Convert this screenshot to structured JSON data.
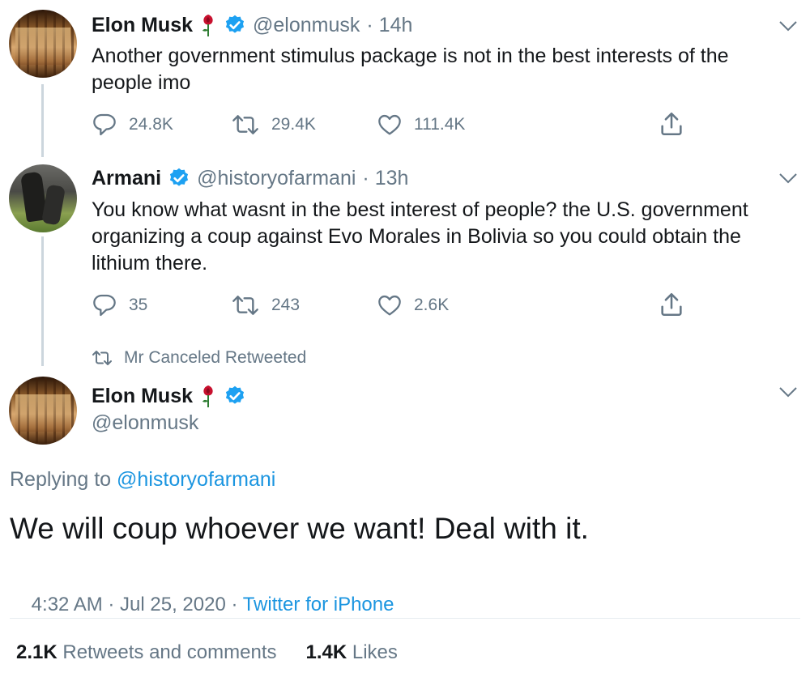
{
  "tweet1": {
    "name": "Elon Musk",
    "handle": "@elonmusk",
    "time": "· 14h",
    "text_line1": "Another government stimulus package is not in the best interests of the",
    "text_line2": "people imo",
    "replies": "24.8K",
    "retweets": "29.4K",
    "likes": "111.4K"
  },
  "tweet2": {
    "name": "Armani",
    "handle": "@historyofarmani",
    "time": "· 13h",
    "text_line1": "You know what wasnt in the best interest of people? the U.S. government",
    "text_line2": "organizing a coup against Evo Morales in Bolivia so you could obtain the",
    "text_line3": "lithium there.",
    "replies": "35",
    "retweets": "243",
    "likes": "2.6K"
  },
  "retweet_context": "Mr Canceled Retweeted",
  "main_tweet": {
    "name": "Elon Musk",
    "handle": "@elonmusk",
    "replying_prefix": "Replying to ",
    "replying_handle": "@historyofarmani",
    "text": "We will coup whoever we want! Deal with it.",
    "timestamp": "4:32 AM · Jul 25, 2020 · ",
    "source": "Twitter for iPhone",
    "retweets_count": "2.1K",
    "retweets_label": "Retweets and comments",
    "likes_count": "1.4K",
    "likes_label": "Likes"
  },
  "icons": {
    "verified": "verified-badge-icon",
    "rose": "rose-emoji-icon",
    "chevron": "chevron-down-icon",
    "reply": "reply-icon",
    "retweet": "retweet-icon",
    "like": "heart-icon",
    "share": "share-icon"
  },
  "colors": {
    "verified_blue": "#1da1f2",
    "link_blue": "#1b95e0",
    "muted_gray": "#657786",
    "rose_red": "#c8102e"
  }
}
